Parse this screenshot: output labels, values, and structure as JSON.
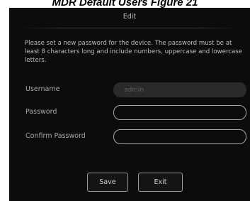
{
  "document": {
    "caption": "MDR Default Users Figure 21"
  },
  "dialog": {
    "title": "Edit",
    "instructions": "Please set a new password for the device. The password must be at least 8 characters long and include numbers, uppercase and lowercase letters.",
    "fields": {
      "username": {
        "label": "Username",
        "value": "admin",
        "readonly": true
      },
      "password": {
        "label": "Password",
        "value": ""
      },
      "confirm_password": {
        "label": "Confirm Password",
        "value": ""
      }
    },
    "buttons": {
      "save": "Save",
      "exit": "Exit"
    }
  },
  "colors": {
    "dialog_background": "#0c0c0c",
    "text": "#bdbdbd",
    "label": "#a9a9a9",
    "input_border": "#a6a6a6",
    "readonly_field": "#2a2a2a"
  }
}
